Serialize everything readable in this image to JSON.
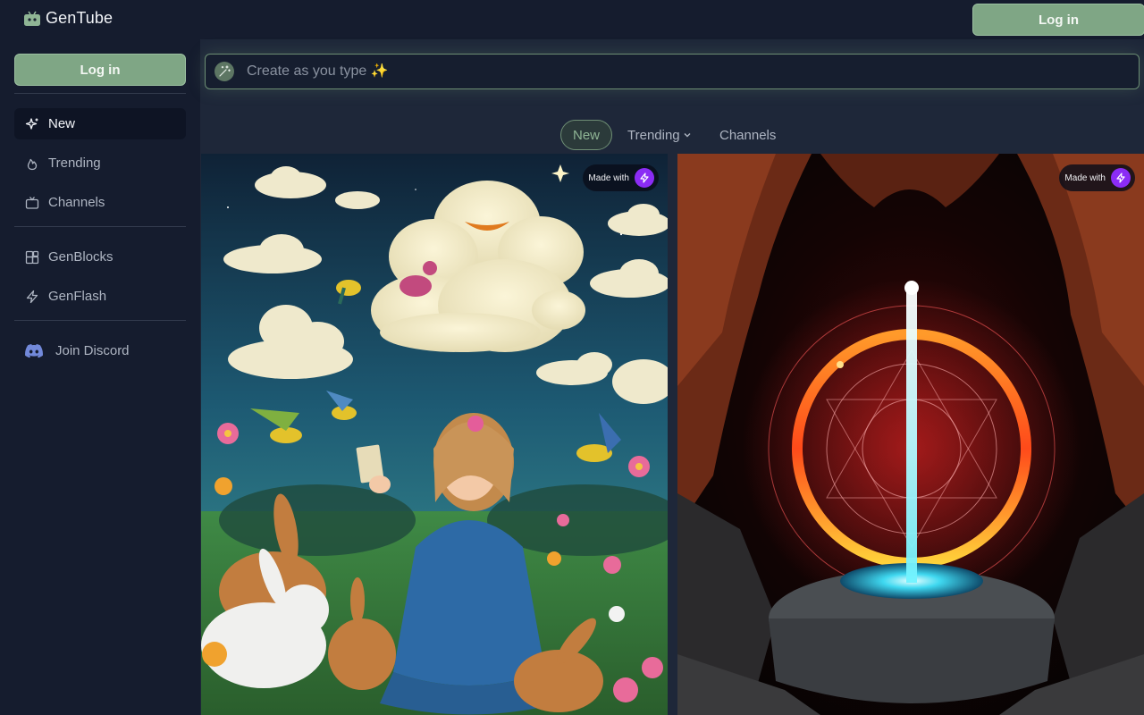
{
  "app": {
    "title": "GenTube",
    "login_label": "Log in"
  },
  "sidebar": {
    "login_label": "Log in",
    "items": [
      {
        "label": "New",
        "icon": "sparkle-icon",
        "active": true
      },
      {
        "label": "Trending",
        "icon": "flame-icon",
        "active": false
      },
      {
        "label": "Channels",
        "icon": "tv-icon",
        "active": false
      },
      {
        "label": "GenBlocks",
        "icon": "blocks-icon",
        "active": false
      },
      {
        "label": "GenFlash",
        "icon": "bolt-icon",
        "active": false
      }
    ],
    "discord_label": "Join Discord"
  },
  "prompt": {
    "placeholder": "Create as you type ✨",
    "value": ""
  },
  "tabs": {
    "new": "New",
    "trending": "Trending",
    "channels": "Channels"
  },
  "cards": [
    {
      "badge": "Made with",
      "subject": "girl-with-rabbits-and-birds-image"
    },
    {
      "badge": "Made with",
      "subject": "magic-portal-in-cave-image"
    }
  ],
  "colors": {
    "accent": "#7fa685",
    "background": "#151c2e",
    "main_bg": "#1e2739",
    "badge_purple": "#8b2cf5",
    "discord": "#7289da"
  }
}
